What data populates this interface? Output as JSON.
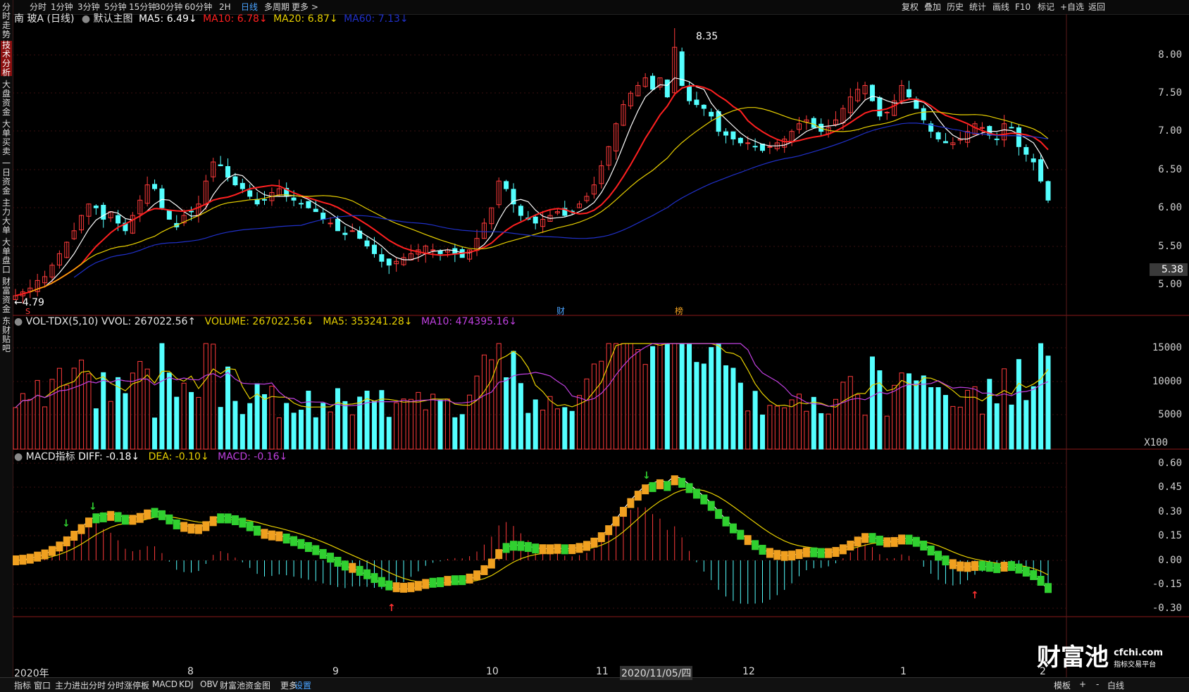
{
  "stock_name": "南 玻A (日线)",
  "topbar": {
    "periods": [
      "分时",
      "1分钟",
      "3分钟",
      "5分钟",
      "15分钟",
      "30分钟",
      "60分钟",
      "2H",
      "日线",
      "多周期",
      "更多 >"
    ],
    "active_period": "日线",
    "right_items": [
      "复权",
      "叠加",
      "历史",
      "统计",
      "画线",
      "F10",
      "标记",
      "+自选",
      "返回"
    ]
  },
  "sidebar": {
    "tabs": [
      "分时走势",
      "技术分析",
      "大盘资金",
      "大单买卖",
      "一日资金",
      "主力大单",
      "大单盘口",
      "财富资金",
      "东财贴吧"
    ],
    "active": "技术分析"
  },
  "main_legend": {
    "default_label": "默认主图",
    "ma5": "MA5: 6.49↓",
    "ma10": "MA10: 6.78↓",
    "ma20": "MA20: 6.87↓",
    "ma60": "MA60: 7.13↓"
  },
  "main_axis": [
    "8.00",
    "7.50",
    "7.00",
    "6.50",
    "6.00",
    "5.50",
    "5.00"
  ],
  "current_price": "5.38",
  "high_label": "8.35",
  "low_label": "4.79",
  "markers": {
    "cai": "财",
    "bang": "榜",
    "s": "S"
  },
  "vol_legend": {
    "name": "VOL-TDX(5,10)",
    "vvol": "VVOL: 267022.56↑",
    "volume": "VOLUME: 267022.56↓",
    "ma5": "MA5: 353241.28↓",
    "ma10": "MA10: 474395.16↓"
  },
  "vol_axis": [
    "15000",
    "10000",
    "5000"
  ],
  "vol_unit": "X100",
  "macd_legend": {
    "name": "MACD指标",
    "diff": "DIFF: -0.18↓",
    "dea": "DEA: -0.10↓",
    "macd": "MACD: -0.16↓"
  },
  "macd_axis": [
    "0.60",
    "0.45",
    "0.30",
    "0.15",
    "0.00",
    "-0.15",
    "-0.30"
  ],
  "x_axis": [
    "2020年",
    "8",
    "9",
    "10",
    "11",
    "2020/11/05/四",
    "12",
    "1",
    "2"
  ],
  "bottom_tabs": [
    "指标",
    "窗口",
    "主力进出分时",
    "分时涨停板",
    "MACD",
    "KDJ",
    "OBV",
    "财富池资金图",
    "更多",
    "设置"
  ],
  "bottom_active": "设置",
  "bottom_right": [
    "模板",
    "+",
    "-",
    "白线"
  ],
  "logo": {
    "main": "财富池",
    "url": "cfchi.com",
    "sub": "指标交易平台"
  },
  "colors": {
    "up": "#ff3b3b",
    "down": "#54ffff",
    "ma5": "#ffffff",
    "ma10": "#ff2020",
    "ma20": "#e8d000",
    "ma60": "#2030c8",
    "vol_ma10": "#c040e0",
    "macd_pos": "#f0a020",
    "macd_neg": "#30d030"
  },
  "chart_data": {
    "type": "candlestick",
    "closes": [
      4.85,
      4.9,
      4.95,
      5.05,
      5.1,
      5.25,
      5.4,
      5.55,
      5.7,
      5.9,
      6.05,
      6.0,
      5.85,
      5.95,
      5.8,
      5.7,
      5.9,
      6.1,
      6.3,
      6.25,
      6.0,
      5.85,
      5.75,
      5.9,
      5.95,
      6.05,
      6.35,
      6.6,
      6.55,
      6.4,
      6.3,
      6.25,
      6.15,
      6.05,
      6.1,
      6.2,
      6.25,
      6.15,
      6.1,
      6.05,
      6.0,
      5.95,
      5.85,
      5.8,
      5.7,
      5.65,
      5.7,
      5.6,
      5.5,
      5.4,
      5.3,
      5.25,
      5.3,
      5.35,
      5.4,
      5.45,
      5.5,
      5.45,
      5.4,
      5.45,
      5.4,
      5.35,
      5.45,
      5.6,
      5.8,
      6.0,
      6.35,
      6.25,
      6.05,
      5.9,
      5.85,
      5.8,
      5.85,
      5.9,
      5.95,
      5.9,
      5.95,
      6.05,
      6.15,
      6.3,
      6.55,
      6.8,
      7.1,
      7.35,
      7.5,
      7.6,
      7.7,
      7.55,
      7.7,
      7.45,
      8.1,
      7.6,
      7.4,
      7.35,
      7.3,
      7.2,
      7.0,
      6.95,
      6.9,
      6.85,
      6.85,
      6.8,
      6.75,
      6.8,
      6.85,
      6.9,
      7.0,
      7.1,
      7.15,
      7.05,
      7.0,
      7.05,
      7.15,
      7.3,
      7.45,
      7.55,
      7.6,
      7.4,
      7.2,
      7.25,
      7.4,
      7.6,
      7.45,
      7.3,
      7.15,
      7.0,
      6.9,
      6.85,
      6.85,
      6.9,
      7.0,
      7.1,
      7.05,
      6.95,
      6.9,
      7.1,
      7.05,
      6.8,
      6.7,
      6.6,
      6.35,
      6.1
    ]
  }
}
